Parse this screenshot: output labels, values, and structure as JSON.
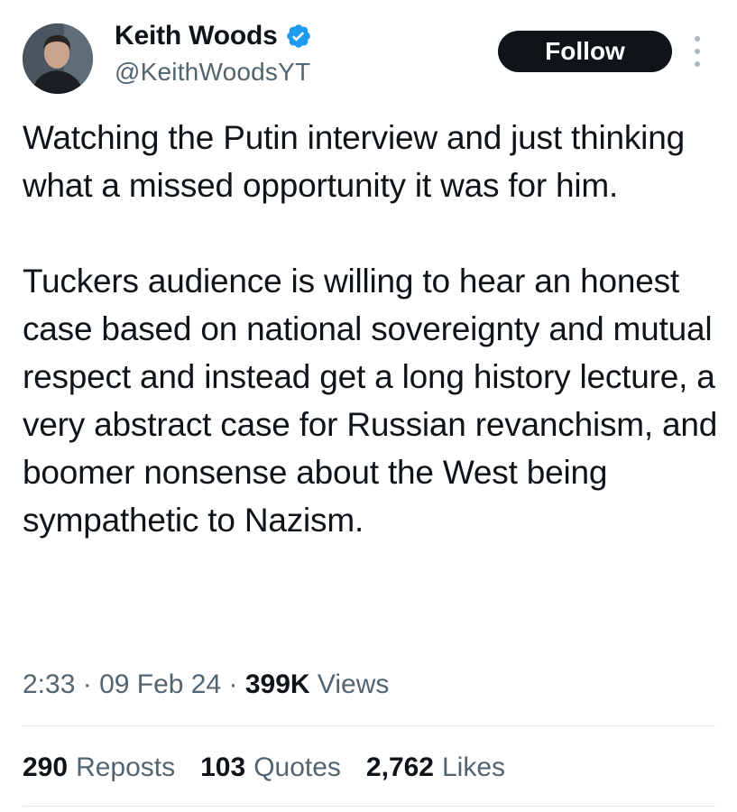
{
  "author": {
    "display_name": "Keith Woods",
    "handle": "@KeithWoodsYT",
    "verified_icon": "verified-badge-icon",
    "verified_color": "#1d9bf0"
  },
  "actions": {
    "follow_label": "Follow",
    "more_icon": "more-vertical-icon"
  },
  "tweet": {
    "paragraphs": [
      "Watching the Putin interview and just thinking what a missed opportunity it was for him.",
      "Tuckers audience is willing to hear an honest case based on national sovereignty and mutual respect and instead get a long history lecture, a very abstract case for Russian revanchism, and boomer nonsense about the West being sympathetic to Nazism."
    ]
  },
  "meta": {
    "time": "2:33",
    "separator": "·",
    "date": "09 Feb 24",
    "views_count": "399K",
    "views_label": "Views"
  },
  "stats": {
    "reposts_count": "290",
    "reposts_label": "Reposts",
    "quotes_count": "103",
    "quotes_label": "Quotes",
    "likes_count": "2,762",
    "likes_label": "Likes"
  },
  "colors": {
    "text_primary": "#0f1419",
    "text_secondary": "#536471",
    "follow_bg": "#0f1419",
    "divider": "#e4e8eb"
  }
}
